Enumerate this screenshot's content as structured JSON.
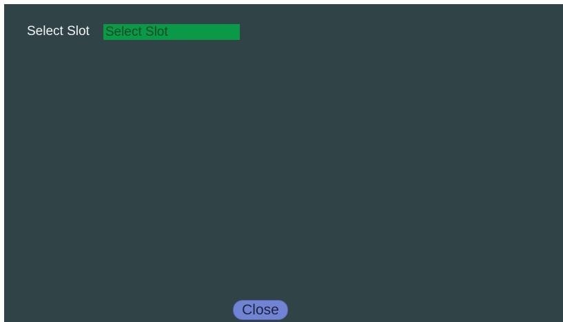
{
  "slot_row": {
    "label": "Select Slot",
    "select_value": "Select Slot"
  },
  "footer": {
    "close_label": "Close"
  },
  "colors": {
    "panel_background": "#304447",
    "select_background": "#0a9a47",
    "close_button_background": "#7184d4"
  }
}
